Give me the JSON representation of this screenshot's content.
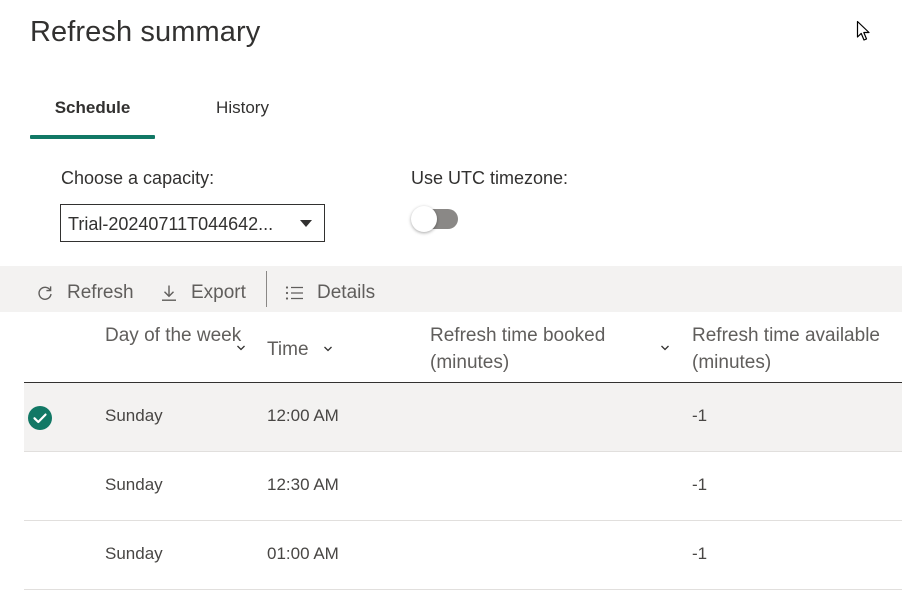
{
  "title": "Refresh summary",
  "tabs": [
    {
      "label": "Schedule",
      "active": true
    },
    {
      "label": "History",
      "active": false
    }
  ],
  "capacity": {
    "label": "Choose a capacity:",
    "value": "Trial-20240711T044642..."
  },
  "utc": {
    "label": "Use UTC timezone:",
    "enabled": false
  },
  "toolbar": {
    "refresh_label": "Refresh",
    "export_label": "Export",
    "details_label": "Details"
  },
  "grid": {
    "columns": {
      "day": "Day of the week",
      "time": "Time",
      "booked": "Refresh time booked (minutes)",
      "available": "Refresh time available (minutes)"
    },
    "rows": [
      {
        "day": "Sunday",
        "time": "12:00 AM",
        "booked": "",
        "available": "-1",
        "selected": true
      },
      {
        "day": "Sunday",
        "time": "12:30 AM",
        "booked": "",
        "available": "-1",
        "selected": false
      },
      {
        "day": "Sunday",
        "time": "01:00 AM",
        "booked": "",
        "available": "-1",
        "selected": false
      }
    ]
  },
  "colors": {
    "accent": "#117865",
    "toolbar_bg": "#f3f2f1",
    "toggle_off": "#8a8886"
  },
  "icons": [
    "refresh-icon",
    "download-icon",
    "list-icon",
    "chevron-down-icon",
    "checkmark-circle-icon",
    "mouse-cursor-icon"
  ]
}
